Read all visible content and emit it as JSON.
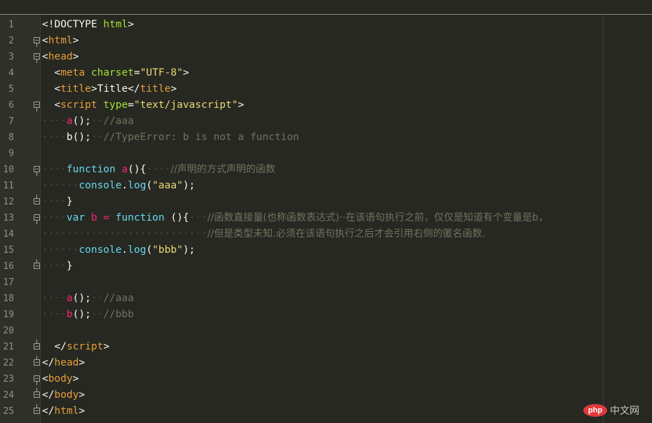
{
  "editor": {
    "line_numbers": [
      "1",
      "2",
      "3",
      "4",
      "5",
      "6",
      "7",
      "8",
      "9",
      "10",
      "11",
      "12",
      "13",
      "14",
      "15",
      "16",
      "17",
      "18",
      "19",
      "20",
      "21",
      "22",
      "23",
      "24",
      "25"
    ],
    "lines": [
      [
        {
          "c": "plain",
          "t": "<!DOCTYPE "
        },
        {
          "c": "attr",
          "t": "html"
        },
        {
          "c": "plain",
          "t": ">"
        }
      ],
      [
        {
          "c": "plain",
          "t": "<"
        },
        {
          "c": "tago",
          "t": "html"
        },
        {
          "c": "plain",
          "t": ">"
        }
      ],
      [
        {
          "c": "plain",
          "t": "<"
        },
        {
          "c": "tago",
          "t": "head"
        },
        {
          "c": "plain",
          "t": ">"
        }
      ],
      [
        {
          "c": "ws",
          "t": "  "
        },
        {
          "c": "plain",
          "t": "<"
        },
        {
          "c": "tago",
          "t": "meta"
        },
        {
          "c": "plain",
          "t": " "
        },
        {
          "c": "attr",
          "t": "charset"
        },
        {
          "c": "plain",
          "t": "="
        },
        {
          "c": "str",
          "t": "\"UTF-8\""
        },
        {
          "c": "plain",
          "t": ">"
        }
      ],
      [
        {
          "c": "ws",
          "t": "  "
        },
        {
          "c": "plain",
          "t": "<"
        },
        {
          "c": "tago",
          "t": "title"
        },
        {
          "c": "plain",
          "t": ">Title</"
        },
        {
          "c": "tago",
          "t": "title"
        },
        {
          "c": "plain",
          "t": ">"
        }
      ],
      [
        {
          "c": "ws",
          "t": "  "
        },
        {
          "c": "plain",
          "t": "<"
        },
        {
          "c": "tago",
          "t": "script"
        },
        {
          "c": "plain",
          "t": " "
        },
        {
          "c": "attr",
          "t": "type"
        },
        {
          "c": "plain",
          "t": "="
        },
        {
          "c": "str",
          "t": "\"text/javascript\""
        },
        {
          "c": "plain",
          "t": ">"
        }
      ],
      [
        {
          "c": "ws",
          "t": "····"
        },
        {
          "c": "fn",
          "t": "a"
        },
        {
          "c": "plain",
          "t": "();"
        },
        {
          "c": "ws",
          "t": "··"
        },
        {
          "c": "cmt",
          "t": "//aaa"
        }
      ],
      [
        {
          "c": "ws",
          "t": "····"
        },
        {
          "c": "plain",
          "t": "b();"
        },
        {
          "c": "ws",
          "t": "··"
        },
        {
          "c": "cmt",
          "t": "//TypeError: b is not a function"
        }
      ],
      [],
      [
        {
          "c": "ws",
          "t": "····"
        },
        {
          "c": "kw",
          "t": "function"
        },
        {
          "c": "plain",
          "t": " "
        },
        {
          "c": "fn",
          "t": "a"
        },
        {
          "c": "plain",
          "t": "(){"
        },
        {
          "c": "ws",
          "t": "····"
        },
        {
          "c": "cmt",
          "t": "//声明的方式声明的函数"
        }
      ],
      [
        {
          "c": "ws",
          "t": "······"
        },
        {
          "c": "kw",
          "t": "console"
        },
        {
          "c": "plain",
          "t": "."
        },
        {
          "c": "kw",
          "t": "log"
        },
        {
          "c": "plain",
          "t": "("
        },
        {
          "c": "str",
          "t": "\"aaa\""
        },
        {
          "c": "plain",
          "t": ");"
        }
      ],
      [
        {
          "c": "ws",
          "t": "····"
        },
        {
          "c": "plain",
          "t": "}"
        }
      ],
      [
        {
          "c": "ws",
          "t": "····"
        },
        {
          "c": "kwv",
          "t": "var"
        },
        {
          "c": "plain",
          "t": " "
        },
        {
          "c": "fn",
          "t": "b"
        },
        {
          "c": "plain",
          "t": " "
        },
        {
          "c": "op",
          "t": "="
        },
        {
          "c": "plain",
          "t": " "
        },
        {
          "c": "kw",
          "t": "function"
        },
        {
          "c": "plain",
          "t": " (){"
        },
        {
          "c": "ws",
          "t": "···"
        },
        {
          "c": "cmt",
          "t": "//函数直接量(也称函数表达式)··在该语句执行之前，仅仅是知道有个变量是b，"
        }
      ],
      [
        {
          "c": "ws",
          "t": "···························"
        },
        {
          "c": "cmt",
          "t": "//但是类型未知.必须在该语句执行之后才会引用右侧的匿名函数."
        }
      ],
      [
        {
          "c": "ws",
          "t": "······"
        },
        {
          "c": "kw",
          "t": "console"
        },
        {
          "c": "plain",
          "t": "."
        },
        {
          "c": "kw",
          "t": "log"
        },
        {
          "c": "plain",
          "t": "("
        },
        {
          "c": "str",
          "t": "\"bbb\""
        },
        {
          "c": "plain",
          "t": ");"
        }
      ],
      [
        {
          "c": "ws",
          "t": "····"
        },
        {
          "c": "plain",
          "t": "}"
        }
      ],
      [],
      [
        {
          "c": "ws",
          "t": "····"
        },
        {
          "c": "fn",
          "t": "a"
        },
        {
          "c": "plain",
          "t": "();"
        },
        {
          "c": "ws",
          "t": "··"
        },
        {
          "c": "cmt",
          "t": "//aaa"
        }
      ],
      [
        {
          "c": "ws",
          "t": "····"
        },
        {
          "c": "fn",
          "t": "b"
        },
        {
          "c": "plain",
          "t": "();"
        },
        {
          "c": "ws",
          "t": "··"
        },
        {
          "c": "cmt",
          "t": "//bbb"
        }
      ],
      [],
      [
        {
          "c": "ws",
          "t": "  "
        },
        {
          "c": "plain",
          "t": "</"
        },
        {
          "c": "tago",
          "t": "script"
        },
        {
          "c": "plain",
          "t": ">"
        }
      ],
      [
        {
          "c": "plain",
          "t": "</"
        },
        {
          "c": "tago",
          "t": "head"
        },
        {
          "c": "plain",
          "t": ">"
        }
      ],
      [
        {
          "c": "plain",
          "t": "<"
        },
        {
          "c": "tago",
          "t": "body"
        },
        {
          "c": "plain",
          "t": ">"
        }
      ],
      [
        {
          "c": "plain",
          "t": "</"
        },
        {
          "c": "tago",
          "t": "body"
        },
        {
          "c": "plain",
          "t": ">"
        }
      ],
      [
        {
          "c": "plain",
          "t": "</"
        },
        {
          "c": "tago",
          "t": "html"
        },
        {
          "c": "plain",
          "t": ">"
        }
      ]
    ],
    "folds": [
      "",
      "open",
      "open",
      "",
      "",
      "open",
      "",
      "",
      "",
      "open",
      "",
      "end",
      "open",
      "",
      "",
      "end",
      "",
      "",
      "",
      "",
      "end",
      "end",
      "open",
      "end",
      "end"
    ]
  },
  "watermark": {
    "logo": "php",
    "text": "中文网"
  },
  "colors": {
    "background": "#272822",
    "gutter": "#2f3129",
    "tag": "#e69f39",
    "attribute": "#a6e22e",
    "string": "#e6db74",
    "keyword": "#66d9ef",
    "function_name": "#f92672",
    "comment": "#75715e"
  }
}
